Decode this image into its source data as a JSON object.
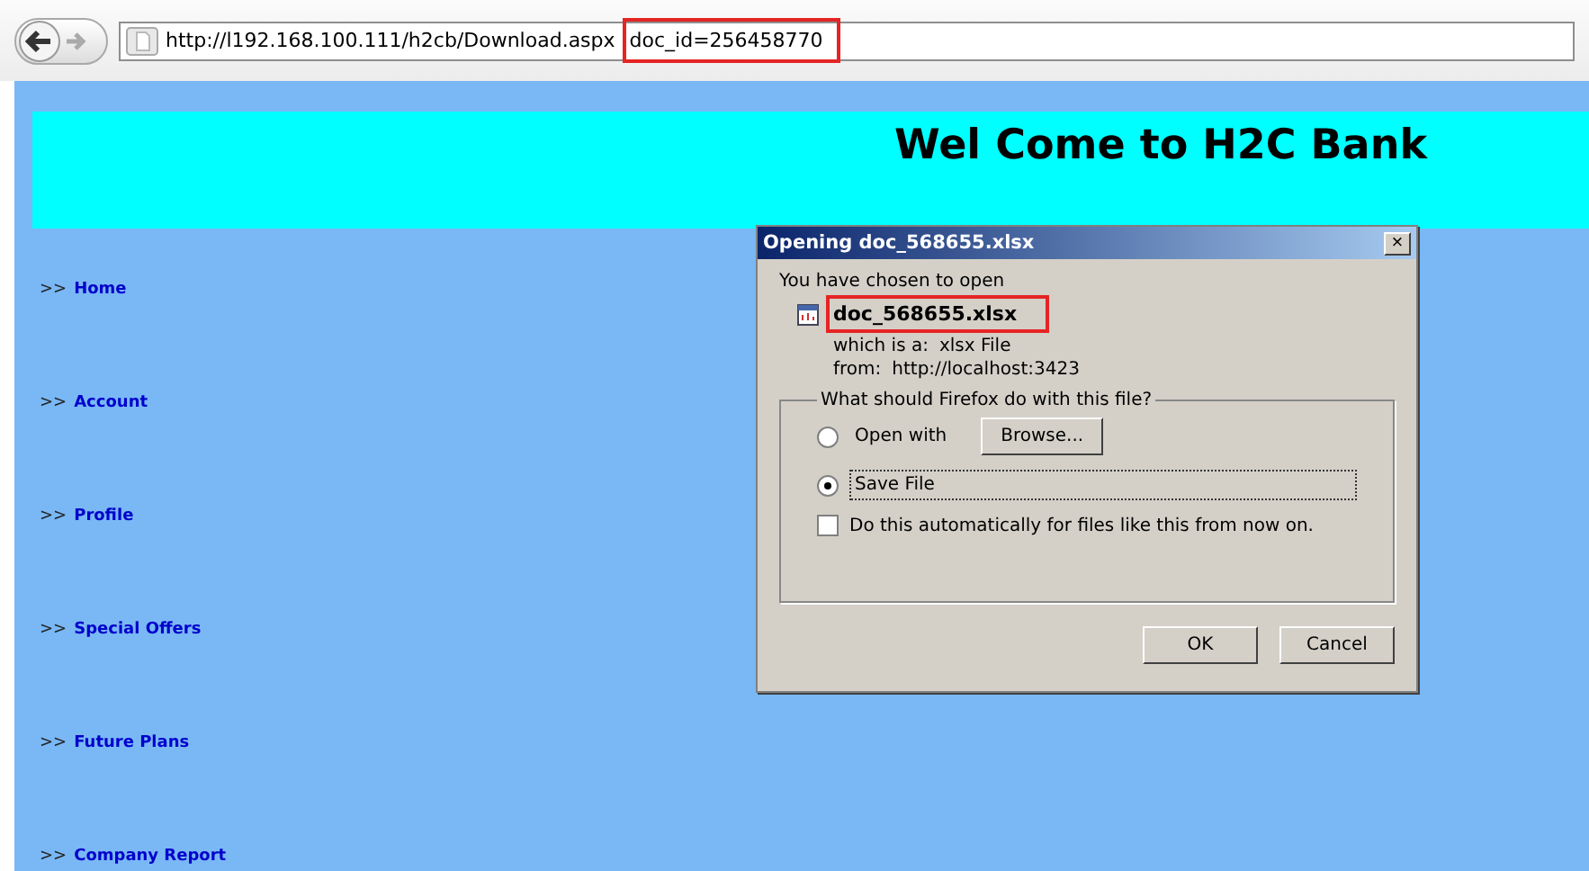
{
  "browser": {
    "url": "http://l192.168.100.111/h2cb/Download.aspx",
    "url_highlighted": "doc_id=256458770"
  },
  "header": {
    "title": "Wel Come to H2C Bank"
  },
  "nav": [
    {
      "prefix": ">>",
      "label": "Home"
    },
    {
      "prefix": ">>",
      "label": "Account"
    },
    {
      "prefix": ">>",
      "label": "Profile"
    },
    {
      "prefix": ">>",
      "label": "Special Offers"
    },
    {
      "prefix": ">>",
      "label": "Future Plans"
    },
    {
      "prefix": ">>",
      "label": "Company Report"
    }
  ],
  "dialog": {
    "title": "Opening doc_568655.xlsx",
    "close": "×",
    "intro": "You have chosen to open",
    "filename": "doc_568655.xlsx",
    "type_label": "which is a:",
    "type_value": "xlsx File",
    "from_label": "from:",
    "from_value": "http://localhost:3423",
    "group_title": "What should Firefox do with this file?",
    "options": [
      {
        "label": "Open with",
        "selected": false,
        "button": "Browse..."
      },
      {
        "label": "Save File",
        "selected": true
      }
    ],
    "auto": {
      "label": "Do this automatically for files like this from now on.",
      "checked": false
    },
    "buttons": [
      "OK",
      "Cancel"
    ]
  }
}
